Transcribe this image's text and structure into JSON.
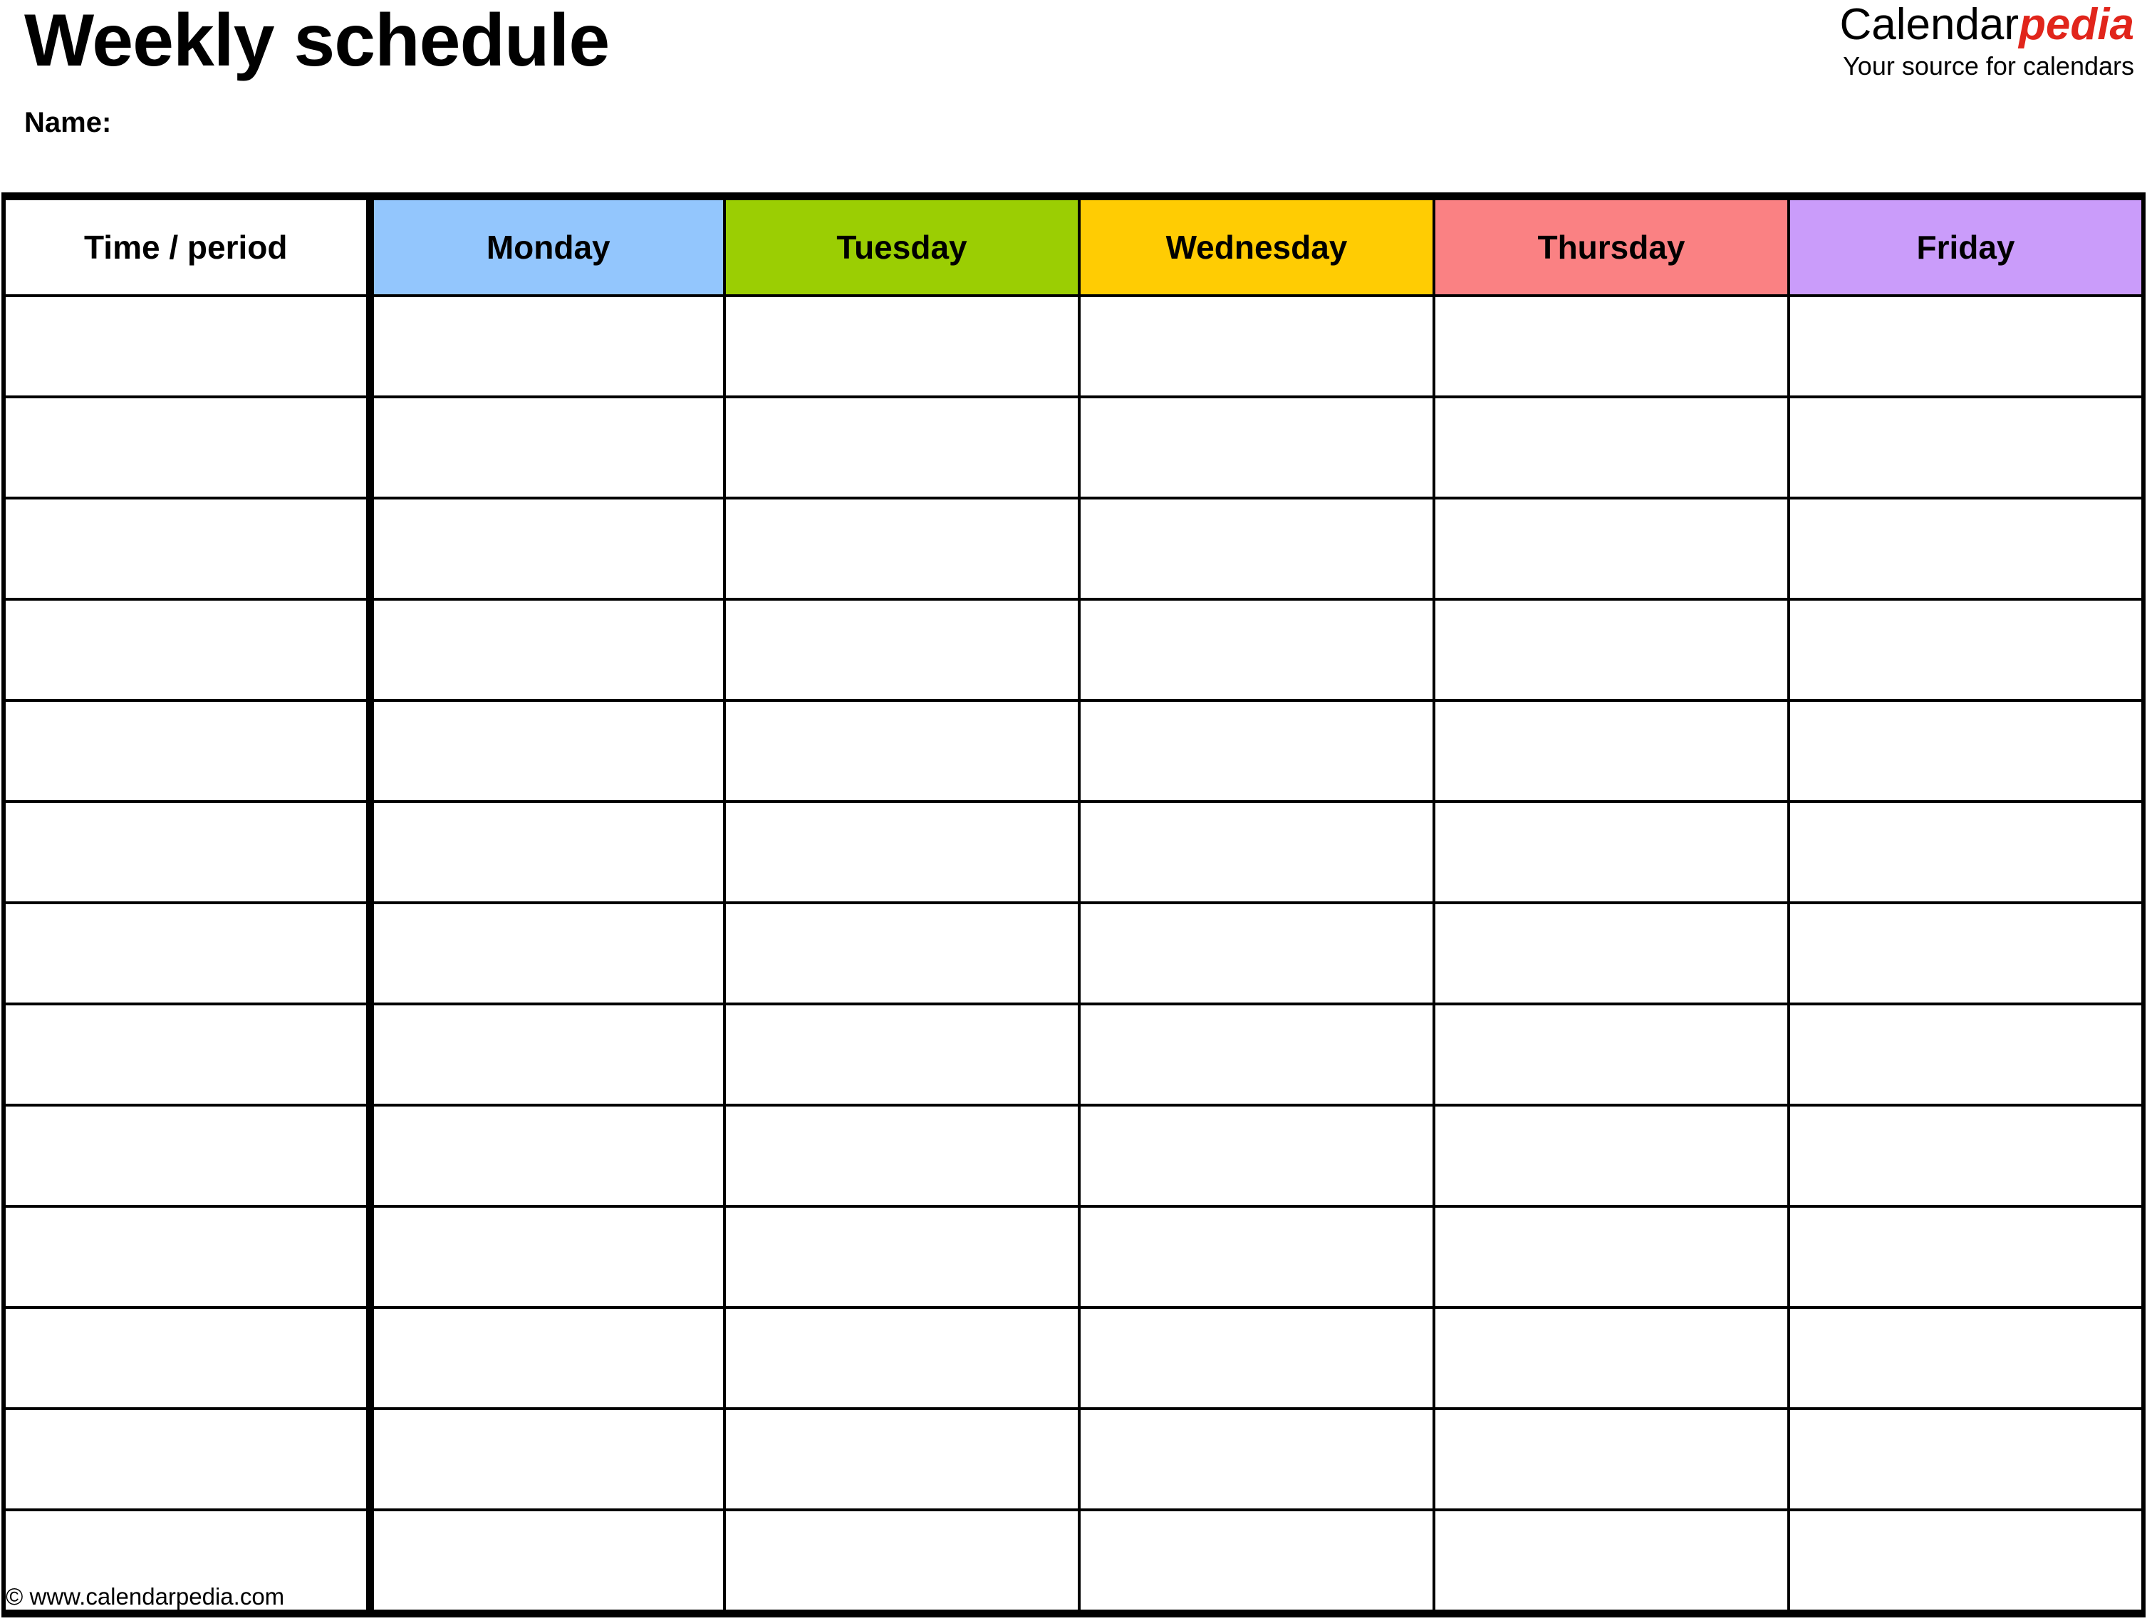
{
  "document": {
    "title": "Weekly schedule",
    "name_label": "Name:"
  },
  "brand": {
    "name_primary": "Calendar",
    "name_accent": "pedia",
    "tagline": "Your source for calendars",
    "accent_color": "#E1251B"
  },
  "table": {
    "columns": [
      {
        "label": "Time / period",
        "color": "#FFFFFF"
      },
      {
        "label": "Monday",
        "color": "#93C6FD"
      },
      {
        "label": "Tuesday",
        "color": "#9BCE03"
      },
      {
        "label": "Wednesday",
        "color": "#FFCC03"
      },
      {
        "label": "Thursday",
        "color": "#FA8183"
      },
      {
        "label": "Friday",
        "color": "#CA9CFA"
      }
    ],
    "row_count": 13,
    "rows": [
      {
        "time": "",
        "monday": "",
        "tuesday": "",
        "wednesday": "",
        "thursday": "",
        "friday": ""
      },
      {
        "time": "",
        "monday": "",
        "tuesday": "",
        "wednesday": "",
        "thursday": "",
        "friday": ""
      },
      {
        "time": "",
        "monday": "",
        "tuesday": "",
        "wednesday": "",
        "thursday": "",
        "friday": ""
      },
      {
        "time": "",
        "monday": "",
        "tuesday": "",
        "wednesday": "",
        "thursday": "",
        "friday": ""
      },
      {
        "time": "",
        "monday": "",
        "tuesday": "",
        "wednesday": "",
        "thursday": "",
        "friday": ""
      },
      {
        "time": "",
        "monday": "",
        "tuesday": "",
        "wednesday": "",
        "thursday": "",
        "friday": ""
      },
      {
        "time": "",
        "monday": "",
        "tuesday": "",
        "wednesday": "",
        "thursday": "",
        "friday": ""
      },
      {
        "time": "",
        "monday": "",
        "tuesday": "",
        "wednesday": "",
        "thursday": "",
        "friday": ""
      },
      {
        "time": "",
        "monday": "",
        "tuesday": "",
        "wednesday": "",
        "thursday": "",
        "friday": ""
      },
      {
        "time": "",
        "monday": "",
        "tuesday": "",
        "wednesday": "",
        "thursday": "",
        "friday": ""
      },
      {
        "time": "",
        "monday": "",
        "tuesday": "",
        "wednesday": "",
        "thursday": "",
        "friday": ""
      },
      {
        "time": "",
        "monday": "",
        "tuesday": "",
        "wednesday": "",
        "thursday": "",
        "friday": ""
      },
      {
        "time": "",
        "monday": "",
        "tuesday": "",
        "wednesday": "",
        "thursday": "",
        "friday": ""
      }
    ]
  },
  "footer": {
    "copyright": "© www.calendarpedia.com"
  }
}
